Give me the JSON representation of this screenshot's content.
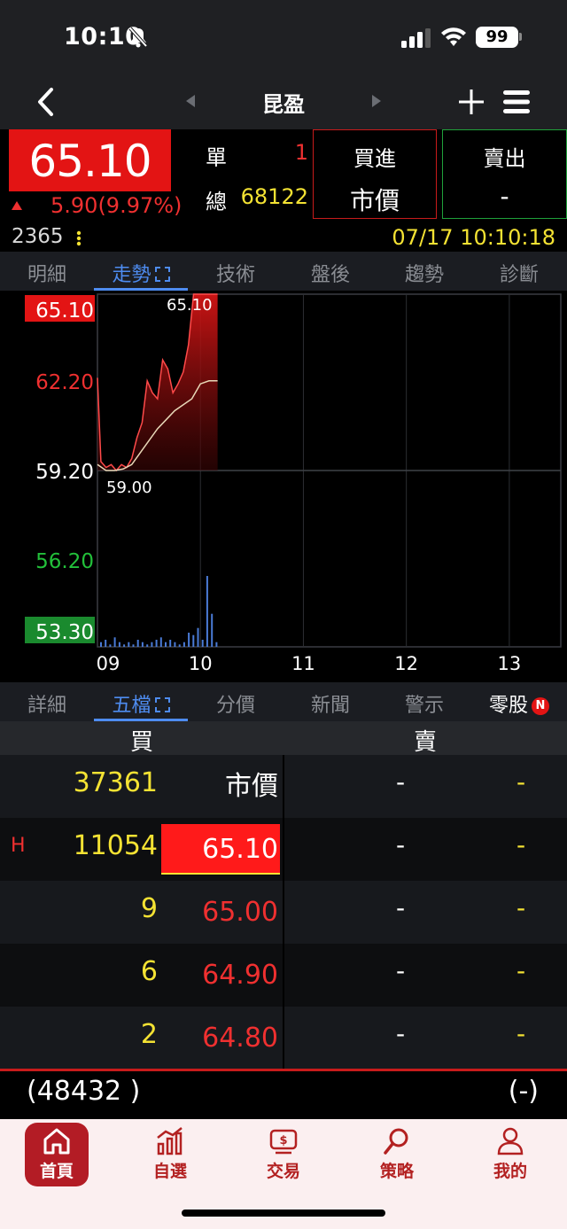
{
  "status_bar": {
    "time": "10:10",
    "battery": "99"
  },
  "nav": {
    "title": "昆盈"
  },
  "quote": {
    "price": "65.10",
    "change": "5.90(9.97%)",
    "single_label": "單",
    "single_value": "1",
    "total_label": "總",
    "total_value": "68122",
    "buy_label": "買進",
    "buy_price": "市價",
    "sell_label": "賣出",
    "sell_price": "-",
    "code": "2365",
    "datetime": "07/17 10:10:18"
  },
  "top_tabs": [
    "明細",
    "走勢",
    "技術",
    "盤後",
    "趨勢",
    "診斷"
  ],
  "chart_data": {
    "type": "area",
    "y_ticks": [
      "65.10",
      "62.20",
      "59.20",
      "56.20",
      "53.30"
    ],
    "ylim": [
      53.3,
      65.1
    ],
    "reference_price": 59.2,
    "x_ticks": [
      "09",
      "10",
      "11",
      "12",
      "13"
    ],
    "annotations": {
      "high": "65.10",
      "low": "59.00"
    },
    "series": [
      {
        "x": [
          "09:00",
          "09:02",
          "09:05",
          "09:08",
          "09:11",
          "09:14",
          "09:17",
          "09:20",
          "09:23",
          "09:26",
          "09:29",
          "09:32",
          "09:35",
          "09:38",
          "09:41",
          "09:44",
          "09:47",
          "09:50",
          "09:53",
          "09:56",
          "09:59",
          "10:02",
          "10:05",
          "10:08",
          "10:10"
        ],
        "values": [
          62.3,
          59.5,
          59.3,
          59.4,
          59.2,
          59.4,
          59.3,
          59.6,
          60.3,
          60.8,
          62.2,
          61.8,
          61.6,
          62.9,
          62.6,
          61.8,
          62.1,
          62.5,
          63.4,
          65.1,
          65.1,
          65.1,
          65.1,
          65.1,
          65.1
        ]
      },
      {
        "name": "avg",
        "x": [
          "09:00",
          "09:05",
          "09:10",
          "09:15",
          "09:20",
          "09:25",
          "09:30",
          "09:35",
          "09:40",
          "09:45",
          "09:50",
          "09:55",
          "10:00",
          "10:05",
          "10:10"
        ],
        "values": [
          59.4,
          59.2,
          59.2,
          59.25,
          59.4,
          59.8,
          60.2,
          60.6,
          60.9,
          61.2,
          61.4,
          61.6,
          62.1,
          62.2,
          62.2
        ]
      }
    ],
    "volume": [
      2,
      3,
      1,
      4,
      2,
      1,
      2,
      1,
      3,
      2,
      1,
      2,
      3,
      4,
      2,
      3,
      2,
      1,
      2,
      6,
      5,
      8,
      3,
      30,
      14,
      2
    ]
  },
  "mid_tabs": [
    "詳細",
    "五檔",
    "分價",
    "新聞",
    "警示",
    "零股"
  ],
  "mid_tab_badge": "N",
  "order_book": {
    "buy_header": "買",
    "sell_header": "賣",
    "rows": [
      {
        "tag": "",
        "buy_vol": "37361",
        "buy_price": "市價",
        "sell_price": "-",
        "sell_vol": "-"
      },
      {
        "tag": "H",
        "buy_vol": "11054",
        "buy_price": "65.10",
        "sell_price": "-",
        "sell_vol": "-"
      },
      {
        "tag": "",
        "buy_vol": "9",
        "buy_price": "65.00",
        "sell_price": "-",
        "sell_vol": "-"
      },
      {
        "tag": "",
        "buy_vol": "6",
        "buy_price": "64.90",
        "sell_price": "-",
        "sell_vol": "-"
      },
      {
        "tag": "",
        "buy_vol": "2",
        "buy_price": "64.80",
        "sell_price": "-",
        "sell_vol": "-"
      }
    ],
    "buy_total": "(48432 )",
    "sell_total": "(-)"
  },
  "bottom_nav": [
    "首頁",
    "自選",
    "交易",
    "策略",
    "我的"
  ],
  "colors": {
    "up": "#ef3030",
    "down": "#22c03a",
    "accent": "#4e8cf0",
    "highlight": "#f4e233",
    "brand": "#b31c25"
  }
}
